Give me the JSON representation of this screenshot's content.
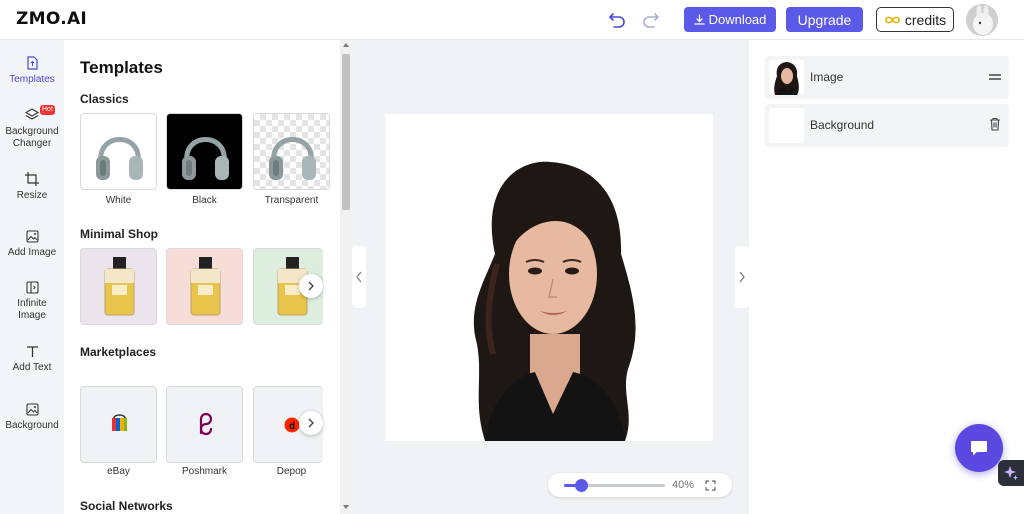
{
  "app": {
    "logo": "ZMO.AI"
  },
  "header": {
    "download_label": "Download",
    "upgrade_label": "Upgrade",
    "credits_label": "credits"
  },
  "toolbar": {
    "items": [
      {
        "label": "Templates",
        "icon": "template-icon"
      },
      {
        "label": "Background\nChanger",
        "icon": "layers-icon",
        "badge": "Hot"
      },
      {
        "label": "Resize",
        "icon": "crop-icon"
      },
      {
        "label": "Add Image",
        "icon": "image-icon"
      },
      {
        "label": "Infinite\nImage",
        "icon": "expand-icon"
      },
      {
        "label": "Add Text",
        "icon": "text-icon"
      },
      {
        "label": "Background",
        "icon": "background-icon"
      }
    ]
  },
  "panel": {
    "title": "Templates",
    "sections": [
      {
        "title": "Classics",
        "items": [
          "White",
          "Black",
          "Transparent"
        ]
      },
      {
        "title": "Minimal Shop",
        "items": [
          "",
          "",
          ""
        ]
      },
      {
        "title": "Marketplaces",
        "items": [
          "eBay",
          "Poshmark",
          "Depop"
        ]
      },
      {
        "title": "Social Networks",
        "items": []
      }
    ]
  },
  "zoom": {
    "value_label": "40%",
    "percent": 40
  },
  "layers": {
    "items": [
      {
        "name": "Image"
      },
      {
        "name": "Background"
      }
    ]
  },
  "colors": {
    "accent": "#5b59e8",
    "chat": "#5b48e0"
  }
}
